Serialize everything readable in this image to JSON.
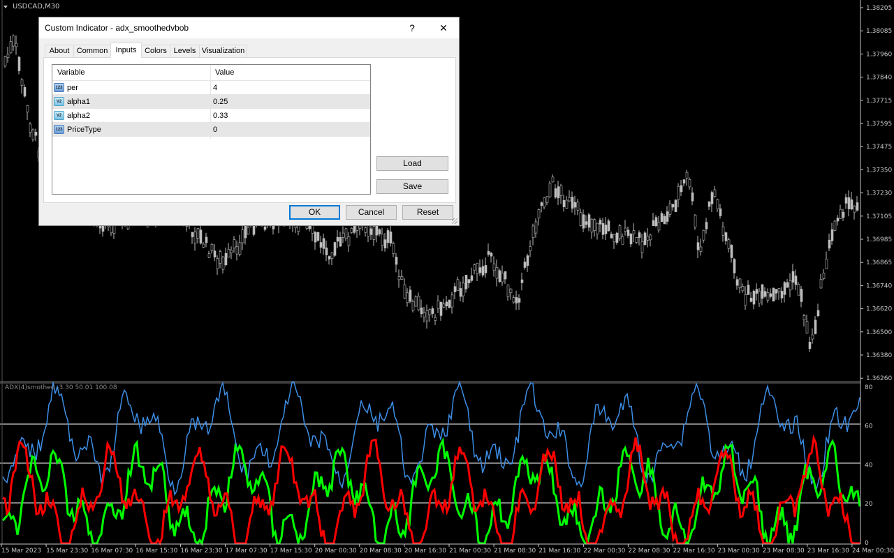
{
  "chart": {
    "symbol": "USDCAD,M30",
    "indicator_label": "ADX(4)smothed -3.30 50.01 100.08",
    "price_ticks": [
      "1.38205",
      "1.38085",
      "1.37960",
      "1.37840",
      "1.37715",
      "1.37595",
      "1.37475",
      "1.37350",
      "1.37230",
      "1.37105",
      "1.36985",
      "1.36865",
      "1.36740",
      "1.36620",
      "1.36500",
      "1.36380",
      "1.36260"
    ],
    "indicator_ticks": [
      "80",
      "60",
      "40",
      "20",
      "0"
    ],
    "time_ticks": [
      "15 Mar 2023",
      "15 Mar 23:30",
      "16 Mar 07:30",
      "16 Mar 15:30",
      "16 Mar 23:30",
      "17 Mar 07:30",
      "17 Mar 15:30",
      "20 Mar 00:30",
      "20 Mar 08:30",
      "20 Mar 16:30",
      "21 Mar 00:30",
      "21 Mar 08:30",
      "21 Mar 16:30",
      "22 Mar 00:30",
      "22 Mar 08:30",
      "22 Mar 16:30",
      "23 Mar 00:30",
      "23 Mar 08:30",
      "23 Mar 16:30",
      "24 Mar 00:30"
    ],
    "colors": {
      "background": "#000000",
      "candle": "#bdbdbd",
      "level_line": "#ffffff",
      "adx": "#3d8ee6",
      "plus_di": "#00ff00",
      "minus_di": "#ff0000",
      "axis_text": "#c8c8c8"
    }
  },
  "dialog": {
    "title": "Custom Indicator - adx_smoothedvbob",
    "help_label": "?",
    "close_label": "✕",
    "tabs": [
      {
        "label": "About"
      },
      {
        "label": "Common"
      },
      {
        "label": "Inputs",
        "active": true
      },
      {
        "label": "Colors"
      },
      {
        "label": "Levels"
      },
      {
        "label": "Visualization"
      }
    ],
    "grid_headers": {
      "variable": "Variable",
      "value": "Value"
    },
    "params": [
      {
        "icon": "123",
        "icon_name": "integer-icon",
        "variable": "per",
        "value": "4"
      },
      {
        "icon": "V2",
        "icon_name": "double-icon",
        "variable": "alpha1",
        "value": "0.25"
      },
      {
        "icon": "V2",
        "icon_name": "double-icon",
        "variable": "alpha2",
        "value": "0.33"
      },
      {
        "icon": "123",
        "icon_name": "integer-icon",
        "variable": "PriceType",
        "value": "0"
      }
    ],
    "buttons": {
      "load": "Load",
      "save": "Save",
      "ok": "OK",
      "cancel": "Cancel",
      "reset": "Reset"
    }
  }
}
